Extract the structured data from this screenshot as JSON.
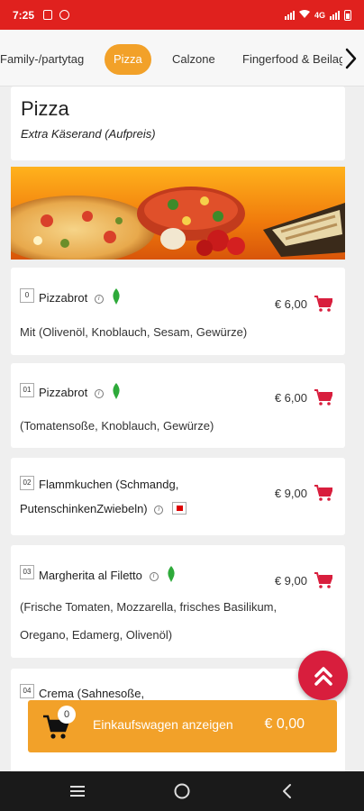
{
  "status": {
    "time": "7:25",
    "network": "4G"
  },
  "categories": {
    "items": [
      {
        "label": "Family-/partytag"
      },
      {
        "label": "Pizza"
      },
      {
        "label": "Calzone"
      },
      {
        "label": "Fingerfood & Beilagen"
      }
    ],
    "active": "Pizza"
  },
  "section": {
    "title": "Pizza",
    "subtitle": "Extra Käserand (Aufpreis)"
  },
  "menu": {
    "items": [
      {
        "number": "0",
        "name": "Pizzabrot",
        "price": "€ 6,00",
        "desc": [
          "Mit (Olivenöl, Knoblauch, Sesam, Gewürze)"
        ]
      },
      {
        "number": "01",
        "name": "Pizzabrot",
        "price": "€ 6,00",
        "desc": [
          "(Tomatensoße, Knoblauch, Gewürze)"
        ]
      },
      {
        "number": "02",
        "name": "Flammkuchen (Schmandg,",
        "name2": "PutenschinkenZwiebeln)",
        "price": "€ 9,00",
        "desc": []
      },
      {
        "number": "03",
        "name": "Margherita al Filetto",
        "price": "€ 9,00",
        "desc": [
          "(Frische Tomaten, Mozzarella, frisches Basilikum,",
          "Oregano, Edamerg, Olivenöl)"
        ]
      },
      {
        "number": "04",
        "name": "Crema (Sahnesoße,",
        "price": "",
        "desc": []
      }
    ]
  },
  "cart": {
    "count": "0",
    "label": "Einkaufswagen anzeigen",
    "total": "€ 0,00"
  },
  "colors": {
    "statusbar": "#e0211e",
    "accent": "#f2a129",
    "fab": "#d81e3d",
    "cart_icon": "#d81e3d",
    "veg": "#2eaa3a"
  },
  "icons": [
    "chevron-right-icon",
    "info-icon",
    "vegetarian-leaf-icon",
    "spicy-flag-icon",
    "add-to-cart-icon",
    "scroll-top-icon",
    "cart-icon",
    "menu-nav-icon",
    "home-nav-icon",
    "back-nav-icon"
  ]
}
